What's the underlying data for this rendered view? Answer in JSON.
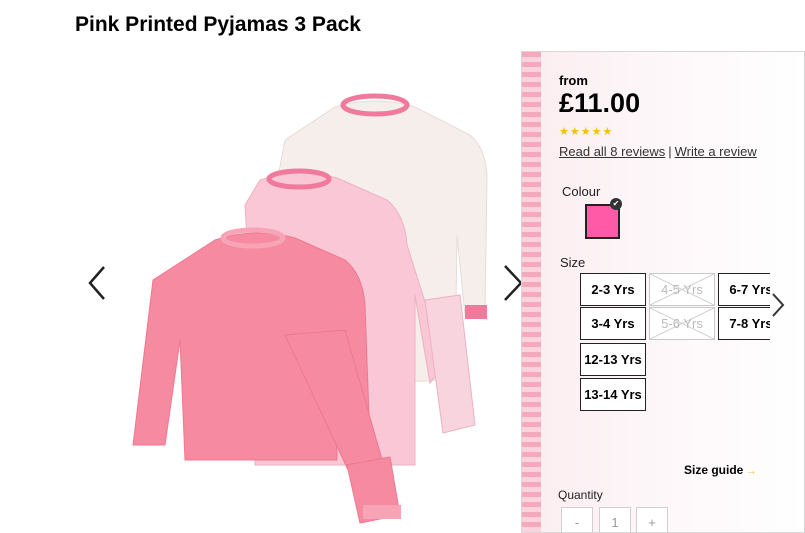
{
  "product": {
    "title": "Pink Printed Pyjamas 3 Pack",
    "image_alt": "Three pink printed pyjama sets"
  },
  "price": {
    "prefix": "from",
    "value": "£11.00"
  },
  "rating": {
    "stars": 5,
    "stars_text": "★★★★★",
    "read_reviews": "Read all 8 reviews",
    "separator": "|",
    "write_review": "Write a review"
  },
  "colour": {
    "label": "Colour",
    "selected_hex": "#ff5aa8"
  },
  "size": {
    "label": "Size",
    "options": [
      {
        "label": "2-3 Yrs",
        "available": true
      },
      {
        "label": "4-5 Yrs",
        "available": false
      },
      {
        "label": "6-7 Yrs",
        "available": true
      },
      {
        "label": "3-4 Yrs",
        "available": true
      },
      {
        "label": "5-6 Yrs",
        "available": false
      },
      {
        "label": "7-8 Yrs",
        "available": true
      },
      {
        "label": "12-13 Yrs",
        "available": true
      },
      {
        "label": "13-14 Yrs",
        "available": true
      }
    ],
    "guide_label": "Size guide"
  },
  "quantity": {
    "label": "Quantity",
    "decrement": "-",
    "value": "1",
    "increment": "+"
  },
  "icons": {
    "gallery_prev": "chevron-left-icon",
    "gallery_next": "chevron-right-icon",
    "sizes_next": "chevron-right-icon",
    "swatch_selected": "check-icon"
  },
  "colors": {
    "accent_stripe": "#f5a9bd",
    "star": "#f5c000",
    "guide_arrow": "#f5b400"
  }
}
